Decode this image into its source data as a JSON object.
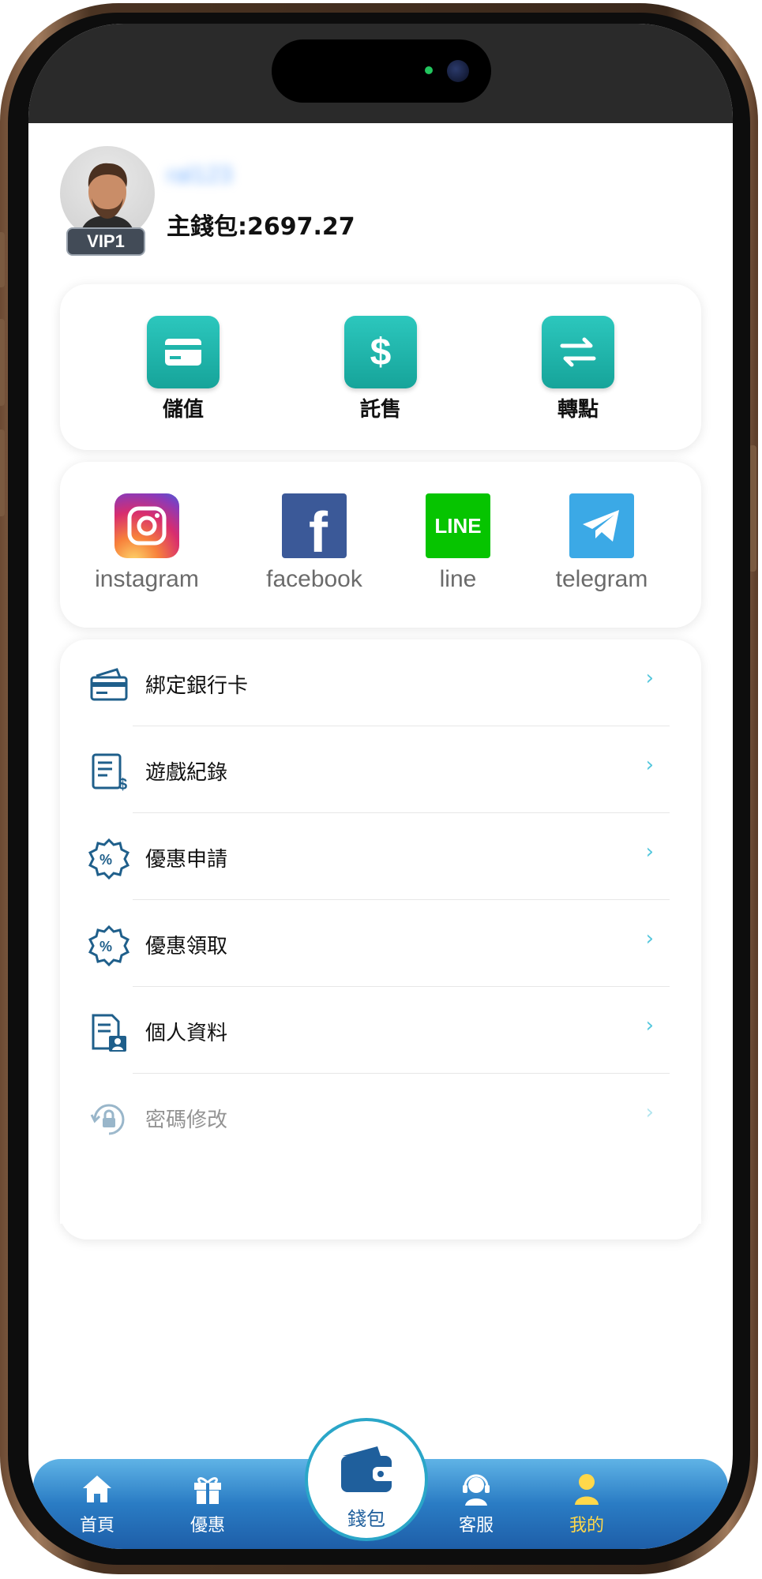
{
  "profile": {
    "username": "ral123",
    "vip_level": "VIP1",
    "main_wallet_label": "主錢包:2697.27"
  },
  "quick_actions": [
    {
      "label": "儲值",
      "icon": "card-icon"
    },
    {
      "label": "託售",
      "icon": "dollar-icon"
    },
    {
      "label": "轉點",
      "icon": "transfer-arrows-icon"
    }
  ],
  "social_links": [
    {
      "label": "instagram",
      "icon": "instagram-icon"
    },
    {
      "label": "facebook",
      "icon": "facebook-icon"
    },
    {
      "label": "line",
      "icon": "line-icon",
      "icon_text": "LINE"
    },
    {
      "label": "telegram",
      "icon": "telegram-icon"
    }
  ],
  "menu": [
    {
      "label": "綁定銀行卡",
      "icon": "bank-card-icon"
    },
    {
      "label": "遊戲紀錄",
      "icon": "game-record-icon"
    },
    {
      "label": "優惠申請",
      "icon": "promo-percent-icon"
    },
    {
      "label": "優惠領取",
      "icon": "promo-percent-icon"
    },
    {
      "label": "個人資料",
      "icon": "profile-document-icon"
    },
    {
      "label": "密碼修改",
      "icon": "lock-refresh-icon"
    }
  ],
  "chevron": "›",
  "bottom_nav": {
    "home": "首頁",
    "promo": "優惠",
    "wallet": "錢包",
    "support": "客服",
    "mine": "我的"
  },
  "colors": {
    "teal_accent": "#1fb5ab",
    "nav_blue": "#2a7cc4",
    "active_yellow": "#ffd84a",
    "chevron": "#54c7dd",
    "icon_blue": "#1f5f8b"
  }
}
